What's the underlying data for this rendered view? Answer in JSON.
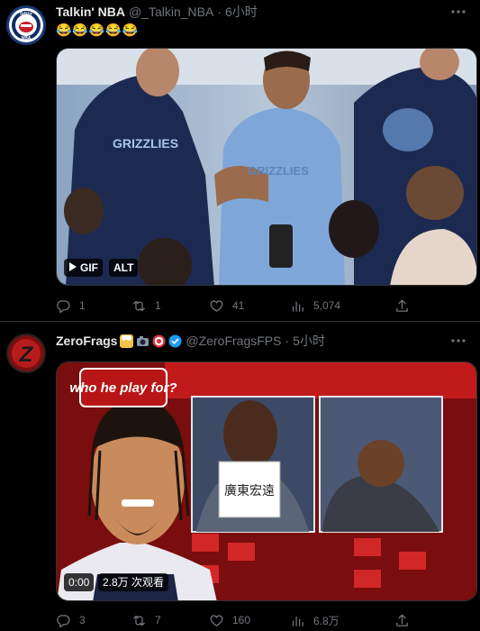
{
  "tweets": [
    {
      "name": "Talkin' NBA",
      "handle": "@_Talkin_NBA",
      "dot": "·",
      "time": "6小时",
      "text": "😂😂😂😂😂",
      "media": {
        "gif_label": "GIF",
        "alt_label": "ALT"
      },
      "stats": {
        "replies": "1",
        "retweets": "1",
        "likes": "41",
        "views": "5,074"
      }
    },
    {
      "name": "ZeroFrags",
      "handle": "@ZeroFragsFPS",
      "dot": "·",
      "time": "5小时",
      "media": {
        "time_label": "0:00",
        "views_label": "2.8万 次观看",
        "banner_text": "who he play for?",
        "sign_text": "廣東宏遠"
      },
      "stats": {
        "replies": "3",
        "retweets": "7",
        "likes": "160",
        "views": "6.8万"
      }
    }
  ],
  "colors": {
    "background": "#000000",
    "text": "#e7e9ea",
    "muted": "#71767b",
    "verified": "#1d9bf0",
    "divider": "#2f3336"
  }
}
